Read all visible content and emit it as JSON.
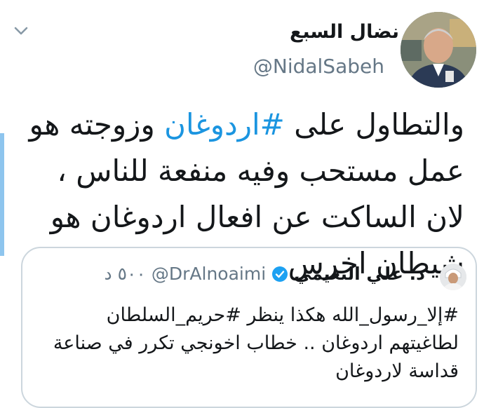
{
  "tweet": {
    "author": {
      "display_name": "نضال السبع",
      "handle": "@NidalSabeh"
    },
    "text_parts": [
      "والتطاول على ",
      "#اردوغان",
      " وزوجته هو عمل مستحب وفيه منفعة للناس ، لان الساكت عن افعال اردوغان هو شيطان اخرس"
    ],
    "menu_icon": "chevron-down-icon"
  },
  "quoted_tweet": {
    "author": {
      "display_name": "د. علي النعيمي",
      "handle": "@DrAlnoaimi",
      "verified": true
    },
    "time": "٥٠٠ د",
    "text": "#إلا_رسول_الله هكذا ينظر #حريم_السلطان لطاغيتهم اردوغان .. خطاب اخونجي تكرر في صناعة قداسة لاردوغان"
  },
  "colors": {
    "link": "#1b95e0",
    "muted": "#657786",
    "border": "#ccd6dd",
    "accent_bar": "#8ec5ee"
  }
}
